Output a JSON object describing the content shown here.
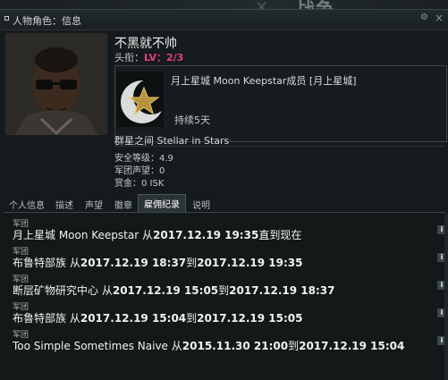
{
  "background": {
    "title": "战争"
  },
  "window": {
    "title": "人物角色：信息"
  },
  "character": {
    "name": "不黑就不帅",
    "rank_label": "头衔：",
    "rank_level": "LV：2/3",
    "corporation": "月上星城 Moon Keepstar成员 [月上星城]",
    "duration": "持续5天",
    "alliance": "群星之间 Stellar in Stars",
    "security": "安全等级：4.9",
    "corp_standing": "军团声望：0",
    "bounty": "赏金：0 ISK"
  },
  "tabs": [
    {
      "label": "个人信息"
    },
    {
      "label": "描述"
    },
    {
      "label": "声望"
    },
    {
      "label": "徽章"
    },
    {
      "label": "雇佣纪录",
      "active": true
    },
    {
      "label": "说明"
    }
  ],
  "history": [
    {
      "label": "军团",
      "corp": "月上星城 Moon Keepstar",
      "from": "2017.12.19 19:35",
      "to": "现在"
    },
    {
      "label": "军团",
      "corp": "布鲁特部族",
      "from": "2017.12.19 18:37",
      "to": "2017.12.19 19:35"
    },
    {
      "label": "军团",
      "corp": "断层矿物研究中心",
      "from": "2017.12.19 15:05",
      "to": "2017.12.19 18:37"
    },
    {
      "label": "军团",
      "corp": "布鲁特部族",
      "from": "2017.12.19 15:04",
      "to": "2017.12.19 15:05"
    },
    {
      "label": "军团",
      "corp": "Too Simple Sometimes Naive",
      "from": "2015.11.30 21:00",
      "to": "2017.12.19 15:04"
    }
  ],
  "text": {
    "from": "从",
    "to": "到",
    "until": "直到"
  },
  "colors": {
    "accent": "#e0407a",
    "background": "#151b1c"
  },
  "icons": [
    "gear-icon",
    "close-icon",
    "info-icon",
    "star-logo"
  ]
}
